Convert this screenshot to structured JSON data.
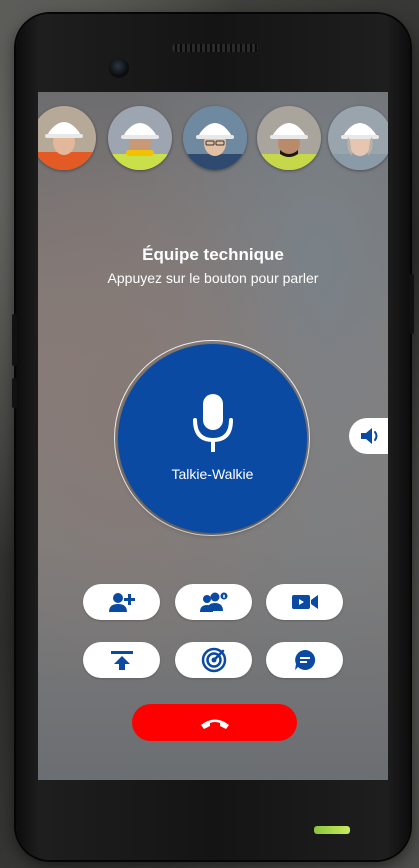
{
  "colors": {
    "accent_blue": "#0b4aa2",
    "end_call_red": "#ff0000",
    "button_bg": "#ffffff"
  },
  "group": {
    "title": "Équipe technique",
    "subtitle": "Appuyez sur le bouton pour parler"
  },
  "avatars": [
    {
      "name": "member-1",
      "helmet": "#ffffff",
      "vest": "#e35a24",
      "skin": "#e2b79a",
      "hair": "#3a2a20"
    },
    {
      "name": "member-2",
      "helmet": "#ffffff",
      "vest": "#c9e04a",
      "skin": "#c99a78",
      "hair": "#2a1e16"
    },
    {
      "name": "member-3",
      "helmet": "#ffffff",
      "vest": "#2f4a6e",
      "skin": "#e3bfa3",
      "hair": "#6b5a48"
    },
    {
      "name": "member-4",
      "helmet": "#ffffff",
      "vest": "#c6d84a",
      "skin": "#b98b6a",
      "hair": "#1e1712"
    },
    {
      "name": "member-5",
      "helmet": "#ffffff",
      "vest": "#8a9aa6",
      "skin": "#e6c6b0",
      "hair": "#b9b2aa"
    }
  ],
  "ptt": {
    "label": "Talkie-Walkie",
    "icon": "microphone-icon"
  },
  "volume": {
    "icon": "speaker-icon"
  },
  "actions": [
    {
      "icon": "add-user-icon"
    },
    {
      "icon": "group-info-icon"
    },
    {
      "icon": "video-call-icon"
    },
    {
      "icon": "upload-icon"
    },
    {
      "icon": "radar-icon"
    },
    {
      "icon": "message-icon"
    }
  ],
  "end_call": {
    "icon": "hang-up-icon"
  }
}
